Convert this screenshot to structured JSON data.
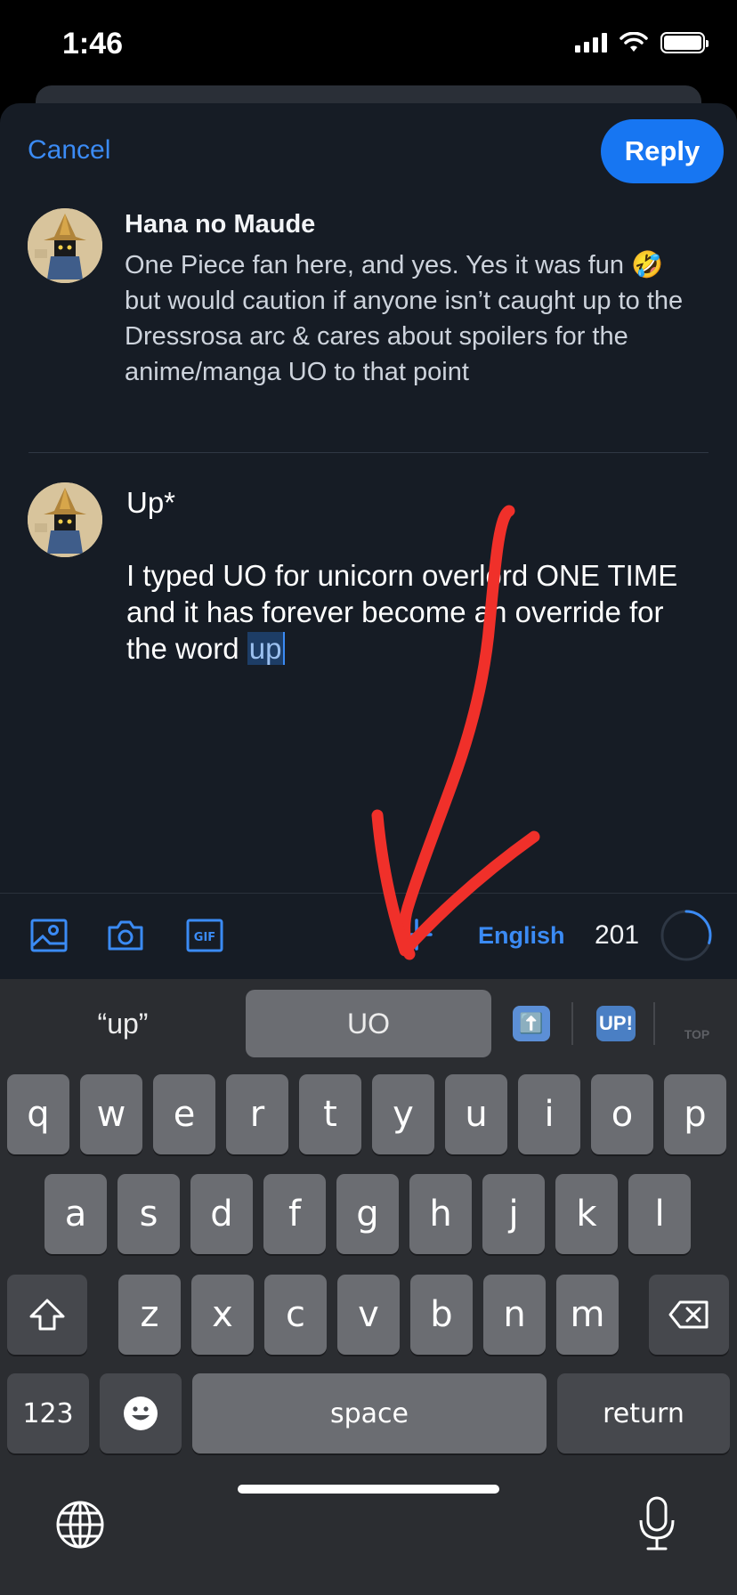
{
  "status_bar": {
    "time": "1:46"
  },
  "header": {
    "cancel_label": "Cancel",
    "reply_label": "Reply"
  },
  "original_post": {
    "author": "Hana no Maude",
    "body": "One Piece fan here, and yes. Yes it was fun 🤣 but would caution if anyone isn’t caught up to the Dressrosa arc & cares about spoilers for the anime/manga UO to that point"
  },
  "reply_draft": {
    "line1": "Up*",
    "line2": "",
    "line3": "I typed UO for unicorn overlord ONE TIME and it has forever become an override for the word ",
    "selected_word": "up"
  },
  "toolbar": {
    "icons": [
      "image-icon",
      "camera-icon",
      "gif-icon",
      "plus-icon"
    ],
    "gif_label": "GIF",
    "language": "English",
    "char_count": "201",
    "char_progress": 0.3
  },
  "keyboard": {
    "suggestions": {
      "left": "“up”",
      "middle": "UO",
      "emoji1": "⬆️",
      "emoji2": "UP!",
      "emoji3": "TOP"
    },
    "row1": [
      "q",
      "w",
      "e",
      "r",
      "t",
      "y",
      "u",
      "i",
      "o",
      "p"
    ],
    "row2": [
      "a",
      "s",
      "d",
      "f",
      "g",
      "h",
      "j",
      "k",
      "l"
    ],
    "row3": [
      "z",
      "x",
      "c",
      "v",
      "b",
      "n",
      "m"
    ],
    "numbers_label": "123",
    "space_label": "space",
    "return_label": "return"
  },
  "annotation": {
    "color": "#f0302a",
    "description": "red-arrow-annotation"
  }
}
